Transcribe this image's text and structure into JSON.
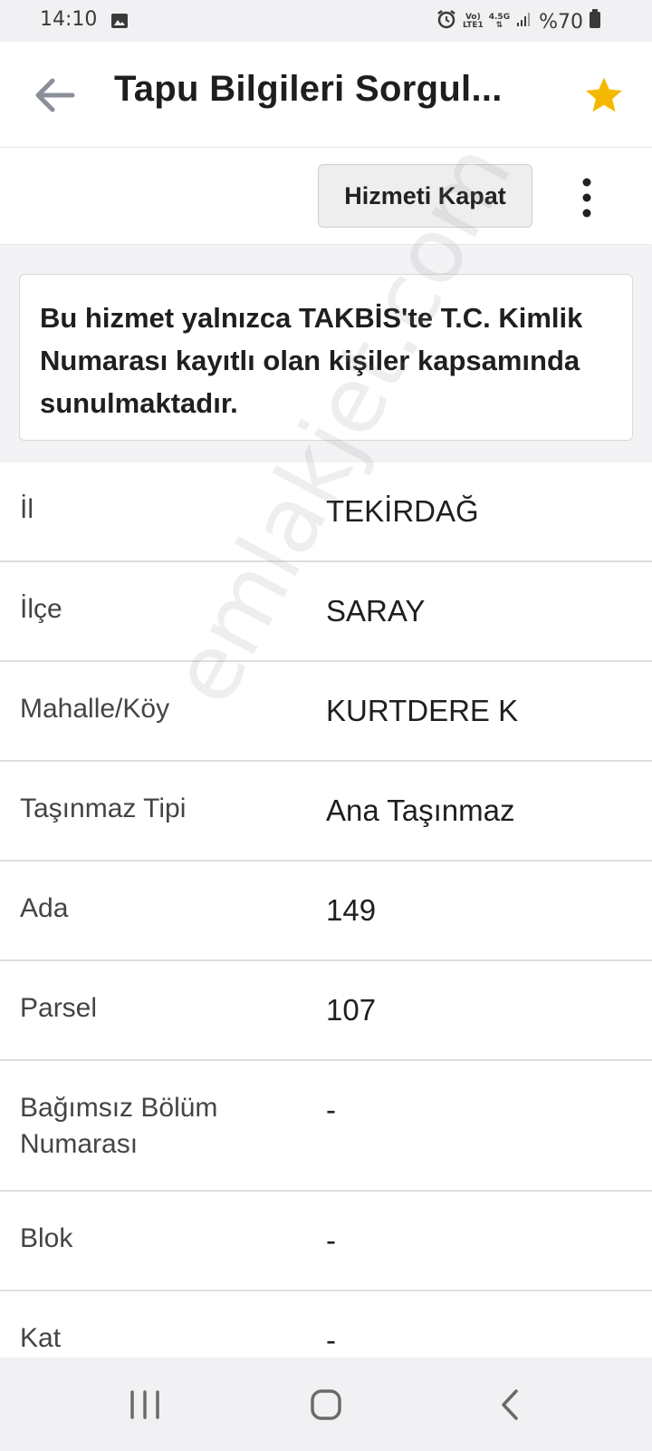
{
  "status_bar": {
    "time": "14:10",
    "network_top": "Vo)",
    "network_bottom": "LTE1",
    "net_speed": "4.5G",
    "battery": "%70",
    "icons": [
      "gallery-icon",
      "alarm-icon",
      "signal-icon",
      "battery-icon"
    ]
  },
  "header": {
    "title": "Tapu Bilgileri Sorgul...",
    "back_icon": "arrow-left-icon",
    "favorite_icon": "star-icon",
    "favorite_color": "#f5b800"
  },
  "toolbar": {
    "close_service_label": "Hizmeti Kapat",
    "more_icon": "more-vert-icon"
  },
  "info_box": {
    "text": "Bu hizmet yalnızca TAKBİS'te T.C. Kimlik Numarası kayıtlı olan kişiler kapsamında sunulmaktadır."
  },
  "rows": [
    {
      "label": "İl",
      "value": "TEKİRDAĞ"
    },
    {
      "label": "İlçe",
      "value": "SARAY"
    },
    {
      "label": "Mahalle/Köy",
      "value": "KURTDERE K"
    },
    {
      "label": "Taşınmaz Tipi",
      "value": "Ana Taşınmaz"
    },
    {
      "label": "Ada",
      "value": "149"
    },
    {
      "label": "Parsel",
      "value": "107"
    },
    {
      "label": "Bağımsız Bölüm Numarası",
      "value": "-"
    },
    {
      "label": "Blok",
      "value": "-"
    },
    {
      "label": "Kat",
      "value": "-"
    }
  ],
  "watermark": "emlakjet.com",
  "nav_bar": {
    "icons": [
      "recent-apps-icon",
      "home-icon",
      "back-icon"
    ]
  }
}
